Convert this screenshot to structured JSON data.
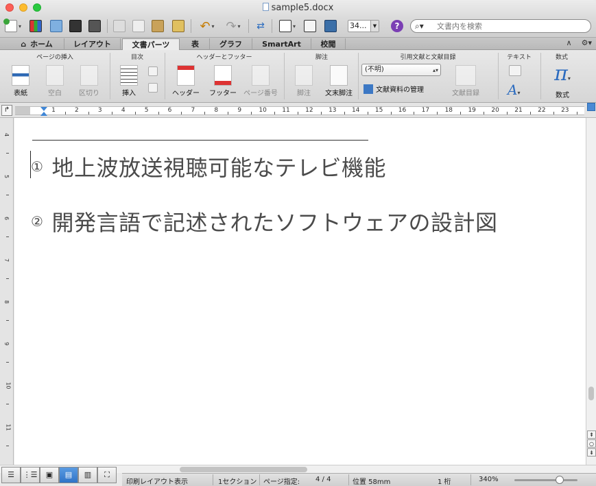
{
  "window": {
    "title": "sample5.docx"
  },
  "toolbar": {
    "zoom_value": "34...",
    "search_placeholder": "文書内を検索"
  },
  "tabs": [
    "ホーム",
    "レイアウト",
    "文書パーツ",
    "表",
    "グラフ",
    "SmartArt",
    "校閲"
  ],
  "active_tab": "文書パーツ",
  "ribbon": {
    "groups": {
      "page_insert": "ページの挿入",
      "toc": "目次",
      "header_footer": "ヘッダーとフッター",
      "footnote": "脚注",
      "citation": "引用文献と文献目録",
      "text": "テキスト",
      "math": "数式"
    },
    "buttons": {
      "cover": "表紙",
      "blank": "空白",
      "break": "区切り",
      "insert": "挿入",
      "header": "ヘッダー",
      "footer": "フッター",
      "page_number": "ページ番号",
      "footnote": "脚注",
      "endnote": "文末脚注",
      "bibliography": "文献目録",
      "equation": "数式"
    },
    "citation_style": "(不明)",
    "manage_sources": "文献資料の管理"
  },
  "ruler": {
    "h_numbers": [
      "1",
      "2",
      "3",
      "4",
      "5",
      "6",
      "7",
      "8",
      "9",
      "10",
      "11",
      "12",
      "13",
      "14",
      "15",
      "16",
      "17",
      "18",
      "19",
      "20",
      "21",
      "22",
      "23"
    ],
    "v_numbers": [
      "4",
      "5",
      "6",
      "7",
      "8",
      "9",
      "10",
      "11"
    ]
  },
  "document": {
    "paragraphs": [
      {
        "num": "①",
        "text": "地上波放送視聴可能なテレビ機能"
      },
      {
        "num": "②",
        "text": "開発言語で記述されたソフトウェアの設計図"
      }
    ]
  },
  "status": {
    "view": "印刷レイアウト表示",
    "section": "1セクション",
    "page_label": "ページ指定:",
    "page_value": "4 / 4",
    "position": "位置 58mm",
    "column": "1 桁",
    "zoom": "340%"
  }
}
